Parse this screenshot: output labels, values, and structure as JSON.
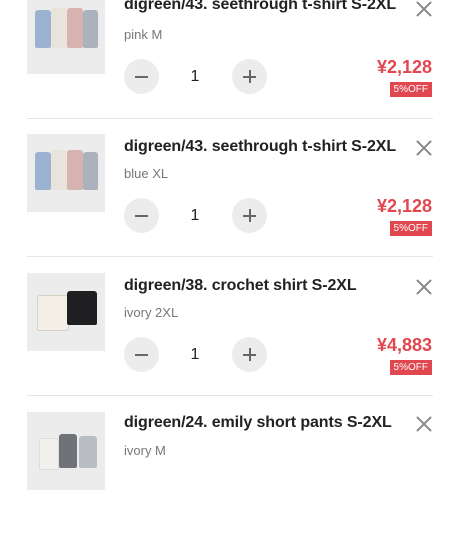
{
  "cart": {
    "items": [
      {
        "title": "digreen/43. seethrough t-shirt S-2XL",
        "variant": "pink M",
        "quantity": "1",
        "price": "¥2,128",
        "discount_badge": "5%OFF",
        "thumb_colors": [
          "#9bb3d0",
          "#e8e4dc",
          "#d7b3b0",
          "#a9b2bd"
        ]
      },
      {
        "title": "digreen/43. seethrough t-shirt S-2XL",
        "variant": "blue XL",
        "quantity": "1",
        "price": "¥2,128",
        "discount_badge": "5%OFF",
        "thumb_colors": [
          "#9bb3d0",
          "#e8e4dc",
          "#d7b3b0",
          "#a9b2bd"
        ]
      },
      {
        "title": "digreen/38. crochet shirt S-2XL",
        "variant": "ivory 2XL",
        "quantity": "1",
        "price": "¥4,883",
        "discount_badge": "5%OFF",
        "thumb_colors": [
          "#f3efe6",
          "#1f1f22"
        ]
      },
      {
        "title": "digreen/24. emily short pants S-2XL",
        "variant": "ivory M",
        "quantity": "",
        "price": "",
        "discount_badge": "",
        "thumb_colors": [
          "#f2f0ec",
          "#6f7378",
          "#b9bcc0"
        ]
      }
    ]
  },
  "icons": {
    "remove": "close-icon",
    "decrease": "minus-icon",
    "increase": "plus-icon"
  },
  "colors": {
    "price": "#e0474f",
    "badge_bg": "#e0474f",
    "stepper_bg": "#ececec",
    "divider": "#e6e6e6"
  }
}
